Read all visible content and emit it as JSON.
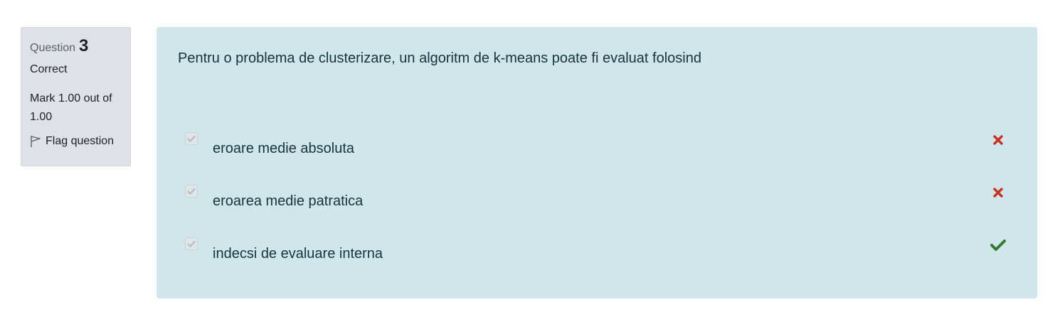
{
  "question_info": {
    "label": "Question",
    "number": "3",
    "state": "Correct",
    "grade": "Mark 1.00 out of 1.00",
    "flag_label": "Flag question"
  },
  "question": {
    "text": "Pentru o problema de clusterizare, un algoritm de k-means poate fi evaluat folosind"
  },
  "answers": [
    {
      "label": "eroare medie absoluta",
      "checked": true,
      "result": "incorrect",
      "icon": "cross-icon"
    },
    {
      "label": "eroarea medie patratica",
      "checked": true,
      "result": "incorrect",
      "icon": "cross-icon"
    },
    {
      "label": "indecsi de evaluare interna",
      "checked": true,
      "result": "correct",
      "icon": "check-icon"
    }
  ],
  "colors": {
    "incorrect": "#ca3120",
    "correct": "#357a32",
    "content_bg": "#cfe6eb",
    "info_bg": "#dee2e6"
  }
}
